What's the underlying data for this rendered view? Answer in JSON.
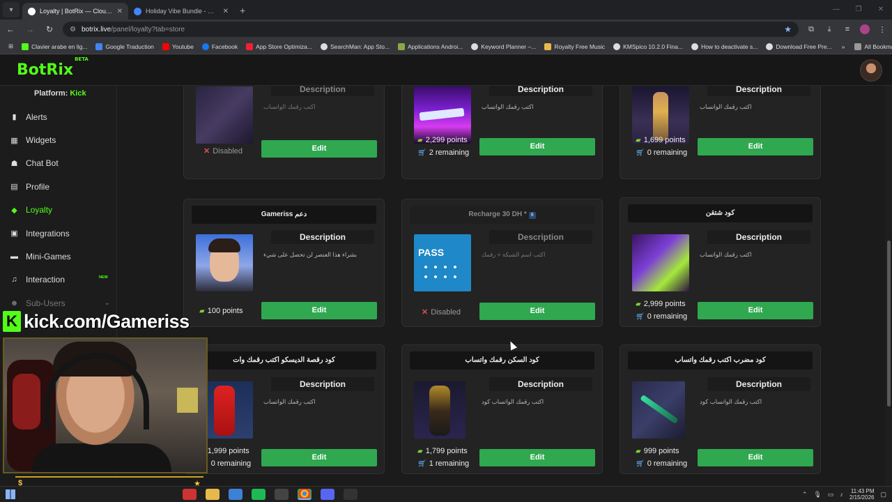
{
  "browser": {
    "tabs": [
      {
        "label": "Loyalty | BotRix — Cloud Stream",
        "active": true
      },
      {
        "label": "Holiday Vibe Bundle - Google S",
        "active": false
      }
    ],
    "url": {
      "host": "botrix.live",
      "path": "/panel/loyalty?tab=store"
    },
    "bookmarks": [
      "Clavier arabe en lig...",
      "Google Traduction",
      "Youtube",
      "Facebook",
      "App Store Optimiza...",
      "SearchMan: App Sto...",
      "Applications Androi...",
      "Keyword Planner –...",
      "Royalty Free Music",
      "KMSpico 10.2.0 Fina...",
      "How to deactivate s...",
      "Download Free Pre..."
    ],
    "all_bookmarks": "All Bookmarks"
  },
  "app": {
    "logo": "BotRix",
    "logo_badge": "BETA",
    "platform_label": "Platform:",
    "platform_value": "Kick",
    "nav": [
      {
        "label": "Alerts",
        "icon": "bell-icon"
      },
      {
        "label": "Widgets",
        "icon": "widgets-icon"
      },
      {
        "label": "Chat Bot",
        "icon": "robot-icon"
      },
      {
        "label": "Profile",
        "icon": "profile-icon"
      },
      {
        "label": "Loyalty",
        "icon": "gem-icon",
        "active": true
      },
      {
        "label": "Integrations",
        "icon": "integrations-icon"
      },
      {
        "label": "Mini-Games",
        "icon": "gamepad-icon"
      },
      {
        "label": "Interaction",
        "icon": "music-icon",
        "badge": "NEW"
      },
      {
        "label": "Sub-Users",
        "icon": "users-icon"
      }
    ]
  },
  "store": {
    "description_heading": "Description",
    "edit_label": "Edit",
    "disabled_label": "Disabled",
    "items": [
      {
        "title": "",
        "desc": "اكتب رقمك الواتساب",
        "disabled": true,
        "points": "",
        "remaining": "",
        "dim": true
      },
      {
        "title": "",
        "desc": "اكتب رقمك الواتساب",
        "disabled": false,
        "points": "2,299 points",
        "remaining": "2 remaining"
      },
      {
        "title": "",
        "desc": "اكتب رقمك الواتساب",
        "disabled": false,
        "points": "1,699 points",
        "remaining": "0 remaining"
      },
      {
        "title": "Gameriss دعم",
        "desc": "بشراء هذا العنصر لن تحصل على شيء",
        "disabled": false,
        "points": "100 points",
        "remaining": ""
      },
      {
        "title": "Recharge 30 DH *",
        "badge": "6",
        "desc": "اكتب اسم الشبكة + رقمك",
        "disabled": true,
        "points": "",
        "remaining": "",
        "dim": true
      },
      {
        "title": "كود شتقن",
        "desc": "اكتب رقمك الواتساب",
        "disabled": false,
        "points": "2,999 points",
        "remaining": "0 remaining"
      },
      {
        "title": "كود رقصة الديسكو اكتب رقمك وات",
        "desc": "اكتب رقمك الواتساب",
        "disabled": false,
        "points": "1,999 points",
        "remaining": "0 remaining"
      },
      {
        "title": "كود السكن رقمك واتساب",
        "desc": "اكتب رقمك الواتساب كود",
        "disabled": false,
        "points": "1,799 points",
        "remaining": "1 remaining"
      },
      {
        "title": "كود مضرب اكتب رقمك واتساب",
        "desc": "اكتب رقمك الواتساب كود",
        "disabled": false,
        "points": "999 points",
        "remaining": "0 remaining"
      }
    ]
  },
  "overlay": {
    "kick_text": "kick.com/Gameriss"
  },
  "taskbar": {
    "time": "11:43 PM",
    "date": "2/15/2026"
  }
}
